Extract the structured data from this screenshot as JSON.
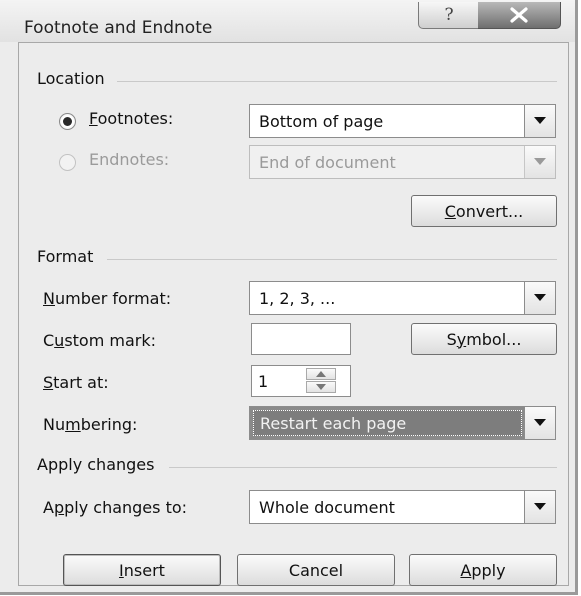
{
  "window": {
    "title": "Footnote and Endnote",
    "help_glyph": "?",
    "close_glyph": "X"
  },
  "location": {
    "group_label": "Location",
    "footnotes": {
      "label_mnemonic": "F",
      "label_rest": "ootnotes:",
      "selected": true,
      "value": "Bottom of page"
    },
    "endnotes": {
      "label": "Endnotes:",
      "selected": false,
      "enabled": false,
      "value": "End of document"
    },
    "convert": {
      "mnemonic": "C",
      "rest": "onvert..."
    }
  },
  "format": {
    "group_label": "Format",
    "number_format": {
      "mnemonic": "N",
      "rest": "umber format:",
      "value": "1, 2, 3, ..."
    },
    "custom_mark": {
      "pre": "C",
      "mnemonic": "u",
      "rest": "stom mark:",
      "value": ""
    },
    "symbol": {
      "pre": "S",
      "mnemonic": "y",
      "rest": "mbol..."
    },
    "start_at": {
      "mnemonic": "S",
      "rest": "tart at:",
      "value": "1"
    },
    "numbering": {
      "pre": "Nu",
      "mnemonic": "m",
      "rest": "bering:",
      "value": "Restart each page"
    }
  },
  "apply_changes": {
    "group_label": "Apply changes",
    "apply_to": {
      "pre": "A",
      "mnemonic": "p",
      "rest": "ply changes to:",
      "value": "Whole document"
    }
  },
  "buttons": {
    "insert": {
      "mnemonic": "I",
      "rest": "nsert"
    },
    "cancel": "Cancel",
    "apply": {
      "mnemonic": "A",
      "rest": "pply"
    }
  }
}
